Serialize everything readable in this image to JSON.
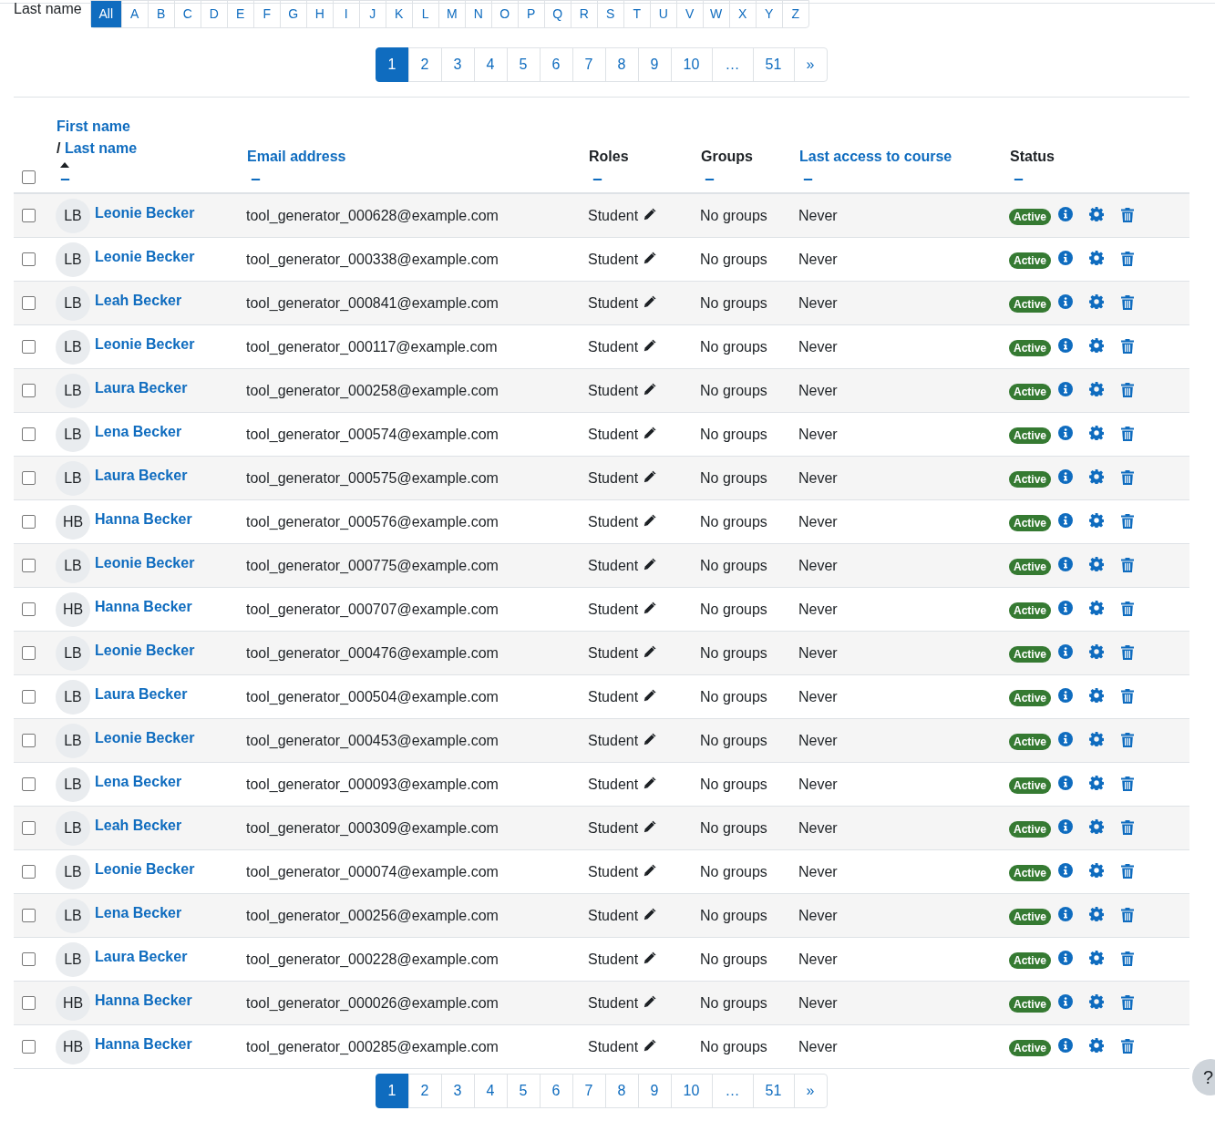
{
  "initials_filter": {
    "label": "Last name",
    "letters": [
      {
        "text": "All",
        "selected": true
      },
      {
        "text": "A",
        "selected": false
      },
      {
        "text": "B",
        "selected": false
      },
      {
        "text": "C",
        "selected": false
      },
      {
        "text": "D",
        "selected": false
      },
      {
        "text": "E",
        "selected": false
      },
      {
        "text": "F",
        "selected": false
      },
      {
        "text": "G",
        "selected": false
      },
      {
        "text": "H",
        "selected": false
      },
      {
        "text": "I",
        "selected": false
      },
      {
        "text": "J",
        "selected": false
      },
      {
        "text": "K",
        "selected": false
      },
      {
        "text": "L",
        "selected": false
      },
      {
        "text": "M",
        "selected": false
      },
      {
        "text": "N",
        "selected": false
      },
      {
        "text": "O",
        "selected": false
      },
      {
        "text": "P",
        "selected": false
      },
      {
        "text": "Q",
        "selected": false
      },
      {
        "text": "R",
        "selected": false
      },
      {
        "text": "S",
        "selected": false
      },
      {
        "text": "T",
        "selected": false
      },
      {
        "text": "U",
        "selected": false
      },
      {
        "text": "V",
        "selected": false
      },
      {
        "text": "W",
        "selected": false
      },
      {
        "text": "X",
        "selected": false
      },
      {
        "text": "Y",
        "selected": false
      },
      {
        "text": "Z",
        "selected": false
      }
    ]
  },
  "pagination_top": [
    {
      "text": "1",
      "selected": true
    },
    {
      "text": "2",
      "selected": false
    },
    {
      "text": "3",
      "selected": false
    },
    {
      "text": "4",
      "selected": false
    },
    {
      "text": "5",
      "selected": false
    },
    {
      "text": "6",
      "selected": false
    },
    {
      "text": "7",
      "selected": false
    },
    {
      "text": "8",
      "selected": false
    },
    {
      "text": "9",
      "selected": false
    },
    {
      "text": "10",
      "selected": false
    },
    {
      "text": "…",
      "selected": false
    },
    {
      "text": "51",
      "selected": false
    },
    {
      "text": "»",
      "selected": false
    }
  ],
  "table": {
    "select_all": {
      "checked": false
    },
    "columns": [
      {
        "labels": [
          "First name",
          "Last name"
        ],
        "separator": "/",
        "sortable": true,
        "sorted_ascending": true
      },
      {
        "labels": [
          "Email address"
        ],
        "sortable": true,
        "sorted_ascending": false
      },
      {
        "labels": [
          "Roles"
        ],
        "sortable": false,
        "sorted_ascending": false
      },
      {
        "labels": [
          "Groups"
        ],
        "sortable": false,
        "sorted_ascending": false
      },
      {
        "labels": [
          "Last access to course"
        ],
        "sortable": true,
        "sorted_ascending": false
      },
      {
        "labels": [
          "Status"
        ],
        "sortable": false,
        "sorted_ascending": false
      }
    ],
    "rows": [
      {
        "checked": false,
        "initials": "LB",
        "name": "Leonie Becker",
        "email": "tool_generator_000628@example.com",
        "role": "Student",
        "groups": "No groups",
        "last_access": "Never",
        "status": "Active"
      },
      {
        "checked": false,
        "initials": "LB",
        "name": "Leonie Becker",
        "email": "tool_generator_000338@example.com",
        "role": "Student",
        "groups": "No groups",
        "last_access": "Never",
        "status": "Active"
      },
      {
        "checked": false,
        "initials": "LB",
        "name": "Leah Becker",
        "email": "tool_generator_000841@example.com",
        "role": "Student",
        "groups": "No groups",
        "last_access": "Never",
        "status": "Active"
      },
      {
        "checked": false,
        "initials": "LB",
        "name": "Leonie Becker",
        "email": "tool_generator_000117@example.com",
        "role": "Student",
        "groups": "No groups",
        "last_access": "Never",
        "status": "Active"
      },
      {
        "checked": false,
        "initials": "LB",
        "name": "Laura Becker",
        "email": "tool_generator_000258@example.com",
        "role": "Student",
        "groups": "No groups",
        "last_access": "Never",
        "status": "Active"
      },
      {
        "checked": false,
        "initials": "LB",
        "name": "Lena Becker",
        "email": "tool_generator_000574@example.com",
        "role": "Student",
        "groups": "No groups",
        "last_access": "Never",
        "status": "Active"
      },
      {
        "checked": false,
        "initials": "LB",
        "name": "Laura Becker",
        "email": "tool_generator_000575@example.com",
        "role": "Student",
        "groups": "No groups",
        "last_access": "Never",
        "status": "Active"
      },
      {
        "checked": false,
        "initials": "HB",
        "name": "Hanna Becker",
        "email": "tool_generator_000576@example.com",
        "role": "Student",
        "groups": "No groups",
        "last_access": "Never",
        "status": "Active"
      },
      {
        "checked": false,
        "initials": "LB",
        "name": "Leonie Becker",
        "email": "tool_generator_000775@example.com",
        "role": "Student",
        "groups": "No groups",
        "last_access": "Never",
        "status": "Active"
      },
      {
        "checked": false,
        "initials": "HB",
        "name": "Hanna Becker",
        "email": "tool_generator_000707@example.com",
        "role": "Student",
        "groups": "No groups",
        "last_access": "Never",
        "status": "Active"
      },
      {
        "checked": false,
        "initials": "LB",
        "name": "Leonie Becker",
        "email": "tool_generator_000476@example.com",
        "role": "Student",
        "groups": "No groups",
        "last_access": "Never",
        "status": "Active"
      },
      {
        "checked": false,
        "initials": "LB",
        "name": "Laura Becker",
        "email": "tool_generator_000504@example.com",
        "role": "Student",
        "groups": "No groups",
        "last_access": "Never",
        "status": "Active"
      },
      {
        "checked": false,
        "initials": "LB",
        "name": "Leonie Becker",
        "email": "tool_generator_000453@example.com",
        "role": "Student",
        "groups": "No groups",
        "last_access": "Never",
        "status": "Active"
      },
      {
        "checked": false,
        "initials": "LB",
        "name": "Lena Becker",
        "email": "tool_generator_000093@example.com",
        "role": "Student",
        "groups": "No groups",
        "last_access": "Never",
        "status": "Active"
      },
      {
        "checked": false,
        "initials": "LB",
        "name": "Leah Becker",
        "email": "tool_generator_000309@example.com",
        "role": "Student",
        "groups": "No groups",
        "last_access": "Never",
        "status": "Active"
      },
      {
        "checked": false,
        "initials": "LB",
        "name": "Leonie Becker",
        "email": "tool_generator_000074@example.com",
        "role": "Student",
        "groups": "No groups",
        "last_access": "Never",
        "status": "Active"
      },
      {
        "checked": false,
        "initials": "LB",
        "name": "Lena Becker",
        "email": "tool_generator_000256@example.com",
        "role": "Student",
        "groups": "No groups",
        "last_access": "Never",
        "status": "Active"
      },
      {
        "checked": false,
        "initials": "LB",
        "name": "Laura Becker",
        "email": "tool_generator_000228@example.com",
        "role": "Student",
        "groups": "No groups",
        "last_access": "Never",
        "status": "Active"
      },
      {
        "checked": false,
        "initials": "HB",
        "name": "Hanna Becker",
        "email": "tool_generator_000026@example.com",
        "role": "Student",
        "groups": "No groups",
        "last_access": "Never",
        "status": "Active"
      },
      {
        "checked": false,
        "initials": "HB",
        "name": "Hanna Becker",
        "email": "tool_generator_000285@example.com",
        "role": "Student",
        "groups": "No groups",
        "last_access": "Never",
        "status": "Active"
      }
    ]
  },
  "pagination_bottom": [
    {
      "text": "1",
      "selected": true
    },
    {
      "text": "2",
      "selected": false
    },
    {
      "text": "3",
      "selected": false
    },
    {
      "text": "4",
      "selected": false
    },
    {
      "text": "5",
      "selected": false
    },
    {
      "text": "6",
      "selected": false
    },
    {
      "text": "7",
      "selected": false
    },
    {
      "text": "8",
      "selected": false
    },
    {
      "text": "9",
      "selected": false
    },
    {
      "text": "10",
      "selected": false
    },
    {
      "text": "…",
      "selected": false
    },
    {
      "text": "51",
      "selected": false
    },
    {
      "text": "»",
      "selected": false
    }
  ],
  "help_button": {
    "text": "?"
  }
}
